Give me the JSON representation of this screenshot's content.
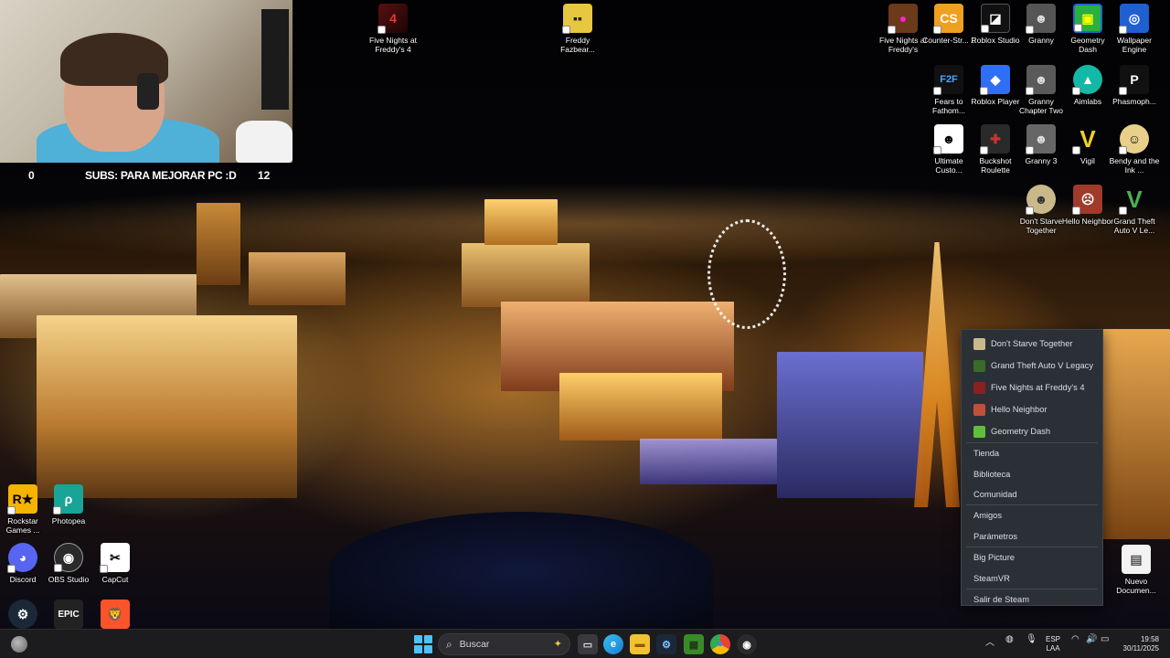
{
  "webcam": {
    "stat_left": "0",
    "subs_text": "SUBS: PARA MEJORAR PC :D",
    "stat_right": "12"
  },
  "desktop": {
    "icons_top": [
      {
        "label": "Five Nights at Freddy's 4",
        "icon": "fnaf4-icon"
      },
      {
        "label": "Freddy Fazbear...",
        "icon": "freddy-icon"
      },
      {
        "label": "Five Nights at Freddy's",
        "icon": "fnaf-icon"
      },
      {
        "label": "Counter-Str... 2",
        "icon": "cs2-icon"
      },
      {
        "label": "Roblox Studio",
        "icon": "roblox-studio-icon"
      },
      {
        "label": "Granny",
        "icon": "granny-icon"
      },
      {
        "label": "Geometry Dash",
        "icon": "geometry-dash-icon"
      },
      {
        "label": "Wallpaper Engine",
        "icon": "wallpaper-engine-icon"
      },
      {
        "label": "Fears to Fathom...",
        "icon": "fears-to-fathom-icon"
      },
      {
        "label": "Roblox Player",
        "icon": "roblox-icon"
      },
      {
        "label": "Granny Chapter Two",
        "icon": "granny2-icon"
      },
      {
        "label": "Aimlabs",
        "icon": "aimlabs-icon"
      },
      {
        "label": "Phasmoph...",
        "icon": "phasmophobia-icon"
      },
      {
        "label": "Ultimate Custo...",
        "icon": "ucn-icon"
      },
      {
        "label": "Buckshot Roulette",
        "icon": "buckshot-icon"
      },
      {
        "label": "Granny 3",
        "icon": "granny3-icon"
      },
      {
        "label": "Vigil",
        "icon": "vigil-icon"
      },
      {
        "label": "Bendy and the Ink ...",
        "icon": "bendy-icon"
      },
      {
        "label": "Don't Starve Together",
        "icon": "dst-icon"
      },
      {
        "label": "Hello Neighbor",
        "icon": "hello-neighbor-icon"
      },
      {
        "label": "Grand Theft Auto V Le...",
        "icon": "gta-icon"
      }
    ],
    "icons_left": [
      {
        "label": "Rockstar Games ...",
        "icon": "rockstar-icon"
      },
      {
        "label": "Photopea",
        "icon": "photopea-icon"
      },
      {
        "label": "Discord",
        "icon": "discord-icon"
      },
      {
        "label": "OBS Studio",
        "icon": "obs-icon"
      },
      {
        "label": "CapCut",
        "icon": "capcut-icon"
      },
      {
        "label": "",
        "icon": "steam-icon"
      },
      {
        "label": "",
        "icon": "epic-games-icon"
      },
      {
        "label": "",
        "icon": "brave-icon"
      }
    ],
    "icon_right_partial": {
      "label": "Nuevo Documen...",
      "icon": "document-icon"
    }
  },
  "steam_menu": {
    "games": [
      {
        "label": "Don't Starve Together",
        "color": "#c9b98a"
      },
      {
        "label": "Grand Theft Auto V Legacy",
        "color": "#3a6b2a"
      },
      {
        "label": "Five Nights at Freddy's 4",
        "color": "#8a2020"
      },
      {
        "label": "Hello Neighbor",
        "color": "#c0503a"
      },
      {
        "label": "Geometry Dash",
        "color": "#5fbf3a"
      }
    ],
    "items": [
      "Tienda",
      "Biblioteca",
      "Comunidad",
      "Amigos",
      "Parámetros",
      "Big Picture",
      "SteamVR",
      "Salir de Steam"
    ]
  },
  "taskbar": {
    "search_placeholder": "Buscar",
    "apps": [
      "task-view-icon",
      "edge-icon",
      "file-explorer-icon",
      "steam-icon",
      "minecraft-icon",
      "chrome-icon",
      "obs-icon"
    ],
    "tray": {
      "lang_line1": "ESP",
      "lang_line2": "LAA",
      "time": "19:58",
      "date": "30/11/2025"
    }
  },
  "colors": {
    "steam_menu_bg": "#2b3037",
    "taskbar_bg": "#1c1c1e",
    "windows_accent": "#4cc2ff"
  }
}
